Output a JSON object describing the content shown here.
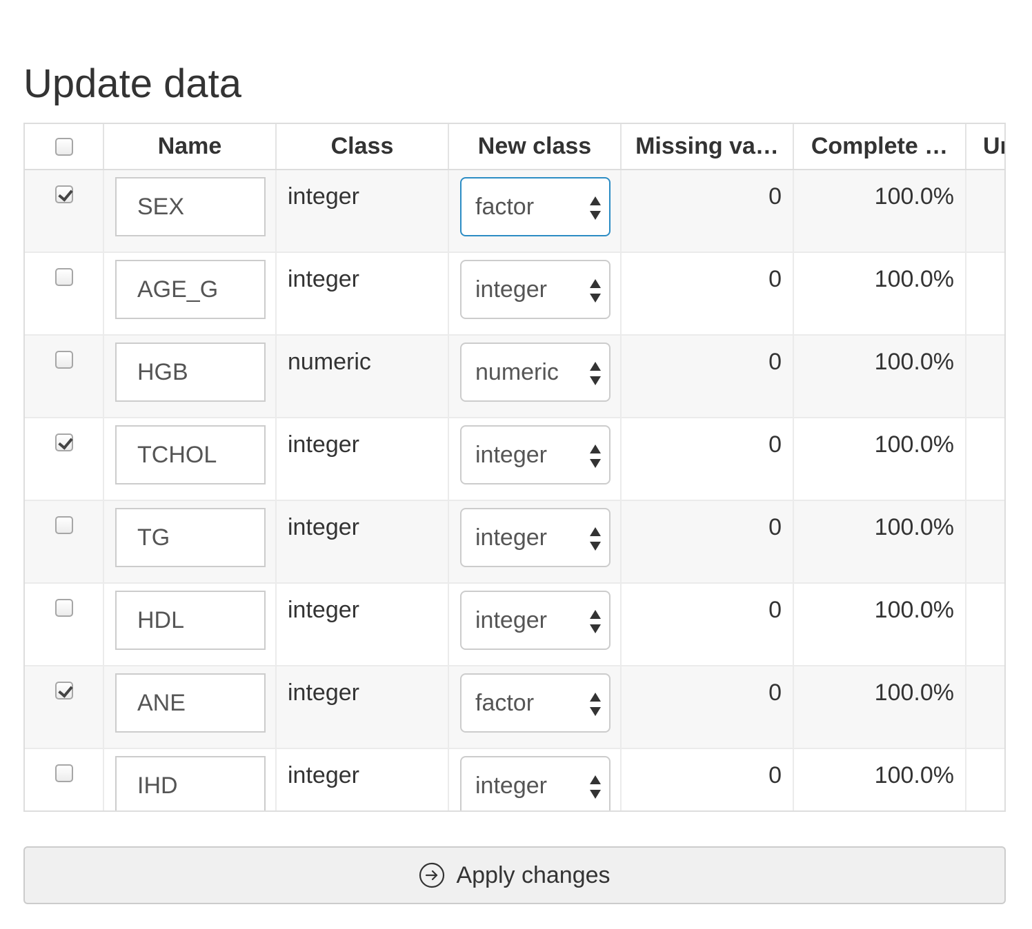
{
  "page": {
    "title": "Update data"
  },
  "table": {
    "headers": {
      "name": "Name",
      "class": "Class",
      "new_class": "New class",
      "missing": "Missing va…",
      "complete": "Complete …",
      "unique": "Un"
    },
    "rows": [
      {
        "selected": true,
        "name": "SEX",
        "class": "integer",
        "new_class": "factor",
        "missing": "0",
        "complete": "100.0%"
      },
      {
        "selected": false,
        "name": "AGE_G",
        "class": "integer",
        "new_class": "integer",
        "missing": "0",
        "complete": "100.0%"
      },
      {
        "selected": false,
        "name": "HGB",
        "class": "numeric",
        "new_class": "numeric",
        "missing": "0",
        "complete": "100.0%"
      },
      {
        "selected": true,
        "name": "TCHOL",
        "class": "integer",
        "new_class": "integer",
        "missing": "0",
        "complete": "100.0%"
      },
      {
        "selected": false,
        "name": "TG",
        "class": "integer",
        "new_class": "integer",
        "missing": "0",
        "complete": "100.0%"
      },
      {
        "selected": false,
        "name": "HDL",
        "class": "integer",
        "new_class": "integer",
        "missing": "0",
        "complete": "100.0%"
      },
      {
        "selected": true,
        "name": "ANE",
        "class": "integer",
        "new_class": "factor",
        "missing": "0",
        "complete": "100.0%"
      },
      {
        "selected": false,
        "name": "IHD",
        "class": "integer",
        "new_class": "integer",
        "missing": "0",
        "complete": "100.0%"
      }
    ]
  },
  "actions": {
    "apply_label": "Apply changes",
    "apply_icon": "arrow-circle-right-icon"
  },
  "colors": {
    "focus_border": "#2b8cc4",
    "row_stripe": "#f7f7f7"
  }
}
